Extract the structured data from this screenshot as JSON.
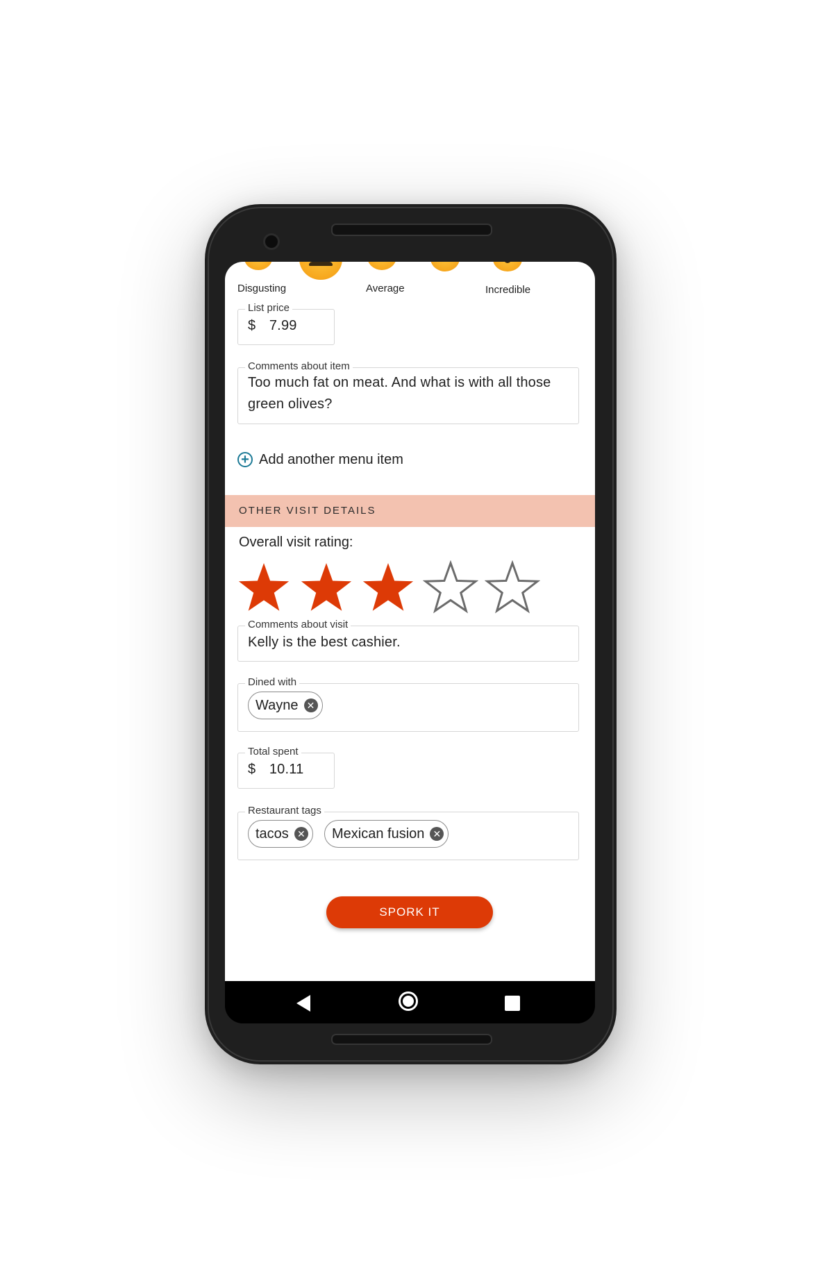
{
  "rating_scale": {
    "labels": [
      "Disgusting",
      "Average",
      "Incredible"
    ]
  },
  "menu_item": {
    "list_price_label": "List price",
    "list_price_currency": "$",
    "list_price_value": "7.99",
    "comments_label": "Comments about item",
    "comments_value": "Too much fat on meat. And what is with all those green olives?",
    "add_item_label": "Add another menu item"
  },
  "visit": {
    "section_title": "OTHER VISIT DETAILS",
    "overall_rating_label": "Overall visit rating:",
    "overall_rating": 3,
    "overall_rating_max": 5,
    "comments_label": "Comments  about visit",
    "comments_value": "Kelly is the best cashier.",
    "dined_with_label": "Dined with",
    "dined_with": [
      "Wayne"
    ],
    "total_spent_label": "Total spent",
    "total_spent_currency": "$",
    "total_spent_value": "10.11",
    "tags_label": "Restaurant tags",
    "tags": [
      "tacos",
      "Mexican fusion"
    ],
    "submit_label": "SPORK IT"
  },
  "colors": {
    "accent": "#dd3a06",
    "section_band": "#f3c2b0",
    "star_filled": "#dd3a06",
    "star_empty_stroke": "#6b6b6b",
    "link_icon": "#1c7a96"
  },
  "icons": {
    "add": "plus-circle-icon",
    "chip_remove": "close-circle-icon",
    "nav_back": "back-triangle-icon",
    "nav_home": "home-circle-icon",
    "nav_recent": "recent-square-icon"
  }
}
